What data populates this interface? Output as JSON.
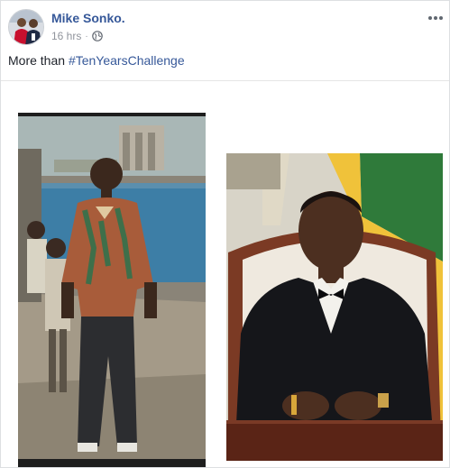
{
  "post": {
    "author_name": "Mike Sonko.",
    "timestamp": "16 hrs",
    "separator": "·",
    "text_prefix": "More than ",
    "hashtag": "#TenYearsChallenge"
  },
  "icons": {
    "privacy": "globe-icon",
    "options": "more-options-icon"
  },
  "colors": {
    "link": "#365899",
    "text": "#1d2129",
    "meta": "#90949c"
  }
}
